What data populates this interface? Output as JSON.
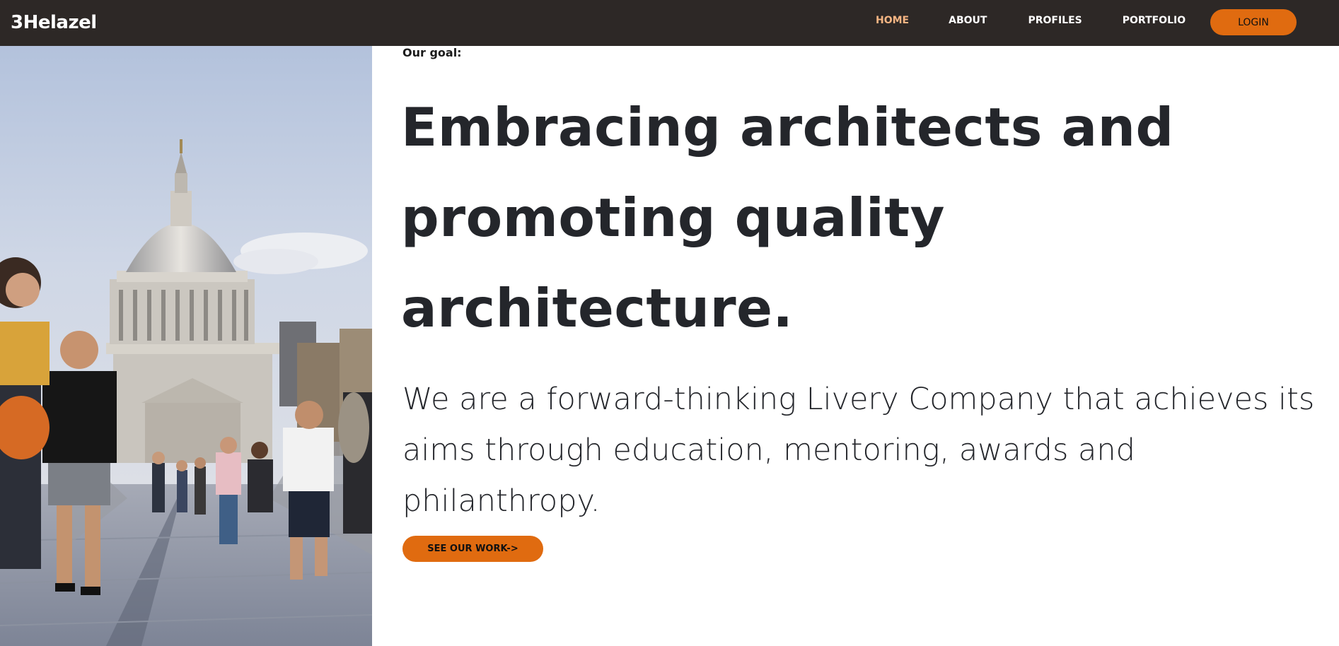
{
  "nav": {
    "brand": "3Helazel",
    "links": [
      {
        "label": "HOME",
        "active": true
      },
      {
        "label": "ABOUT",
        "active": false
      },
      {
        "label": "PROFILES",
        "active": false
      },
      {
        "label": "PORTFOLIO",
        "active": false
      }
    ],
    "login_label": "LOGIN"
  },
  "hero": {
    "eyebrow": "Our goal:",
    "headline": "Embracing architects and promoting quality architecture.",
    "lead": "We are a forward-thinking Livery Company that achieves its aims through education, mentoring, awards and philanthropy.",
    "cta_label": "SEE OUR WORK->",
    "photo_icon": "cathedral-photo"
  },
  "colors": {
    "navbar_bg": "#2d2826",
    "accent": "#e06b10",
    "nav_active": "#f5b583",
    "text": "#24262b"
  }
}
